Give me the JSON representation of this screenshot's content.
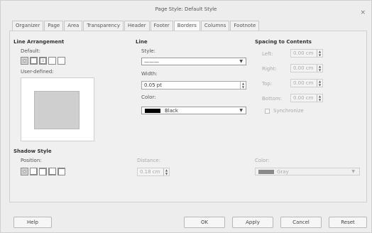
{
  "window": {
    "title": "Page Style: Default Style",
    "close_glyph": "×"
  },
  "tabs": [
    {
      "label": "Organizer"
    },
    {
      "label": "Page"
    },
    {
      "label": "Area"
    },
    {
      "label": "Transparency"
    },
    {
      "label": "Header"
    },
    {
      "label": "Footer"
    },
    {
      "label": "Borders",
      "active": true
    },
    {
      "label": "Columns"
    },
    {
      "label": "Footnote"
    }
  ],
  "line_arrangement": {
    "heading": "Line Arrangement",
    "default_label": "Default:",
    "user_defined_label": "User-defined:"
  },
  "line": {
    "heading": "Line",
    "style_label": "Style:",
    "style_value": "———",
    "width_label": "Width:",
    "width_value": "0.05 pt",
    "color_label": "Color:",
    "color_value": "Black",
    "color_hex": "#000000"
  },
  "spacing": {
    "heading": "Spacing to Contents",
    "left_label": "Left:",
    "left_value": "0.00 cm",
    "right_label": "Right:",
    "right_value": "0.00 cm",
    "top_label": "Top:",
    "top_value": "0.00 cm",
    "bottom_label": "Bottom:",
    "bottom_value": "0.00 cm",
    "sync_label": "Synchronize"
  },
  "shadow": {
    "heading": "Shadow Style",
    "position_label": "Position:",
    "distance_label": "Distance:",
    "distance_value": "0.18 cm",
    "color_label": "Color:",
    "color_value": "Gray",
    "color_hex": "#8a8a8a"
  },
  "buttons": {
    "help": "Help",
    "ok": "OK",
    "apply": "Apply",
    "cancel": "Cancel",
    "reset": "Reset"
  }
}
